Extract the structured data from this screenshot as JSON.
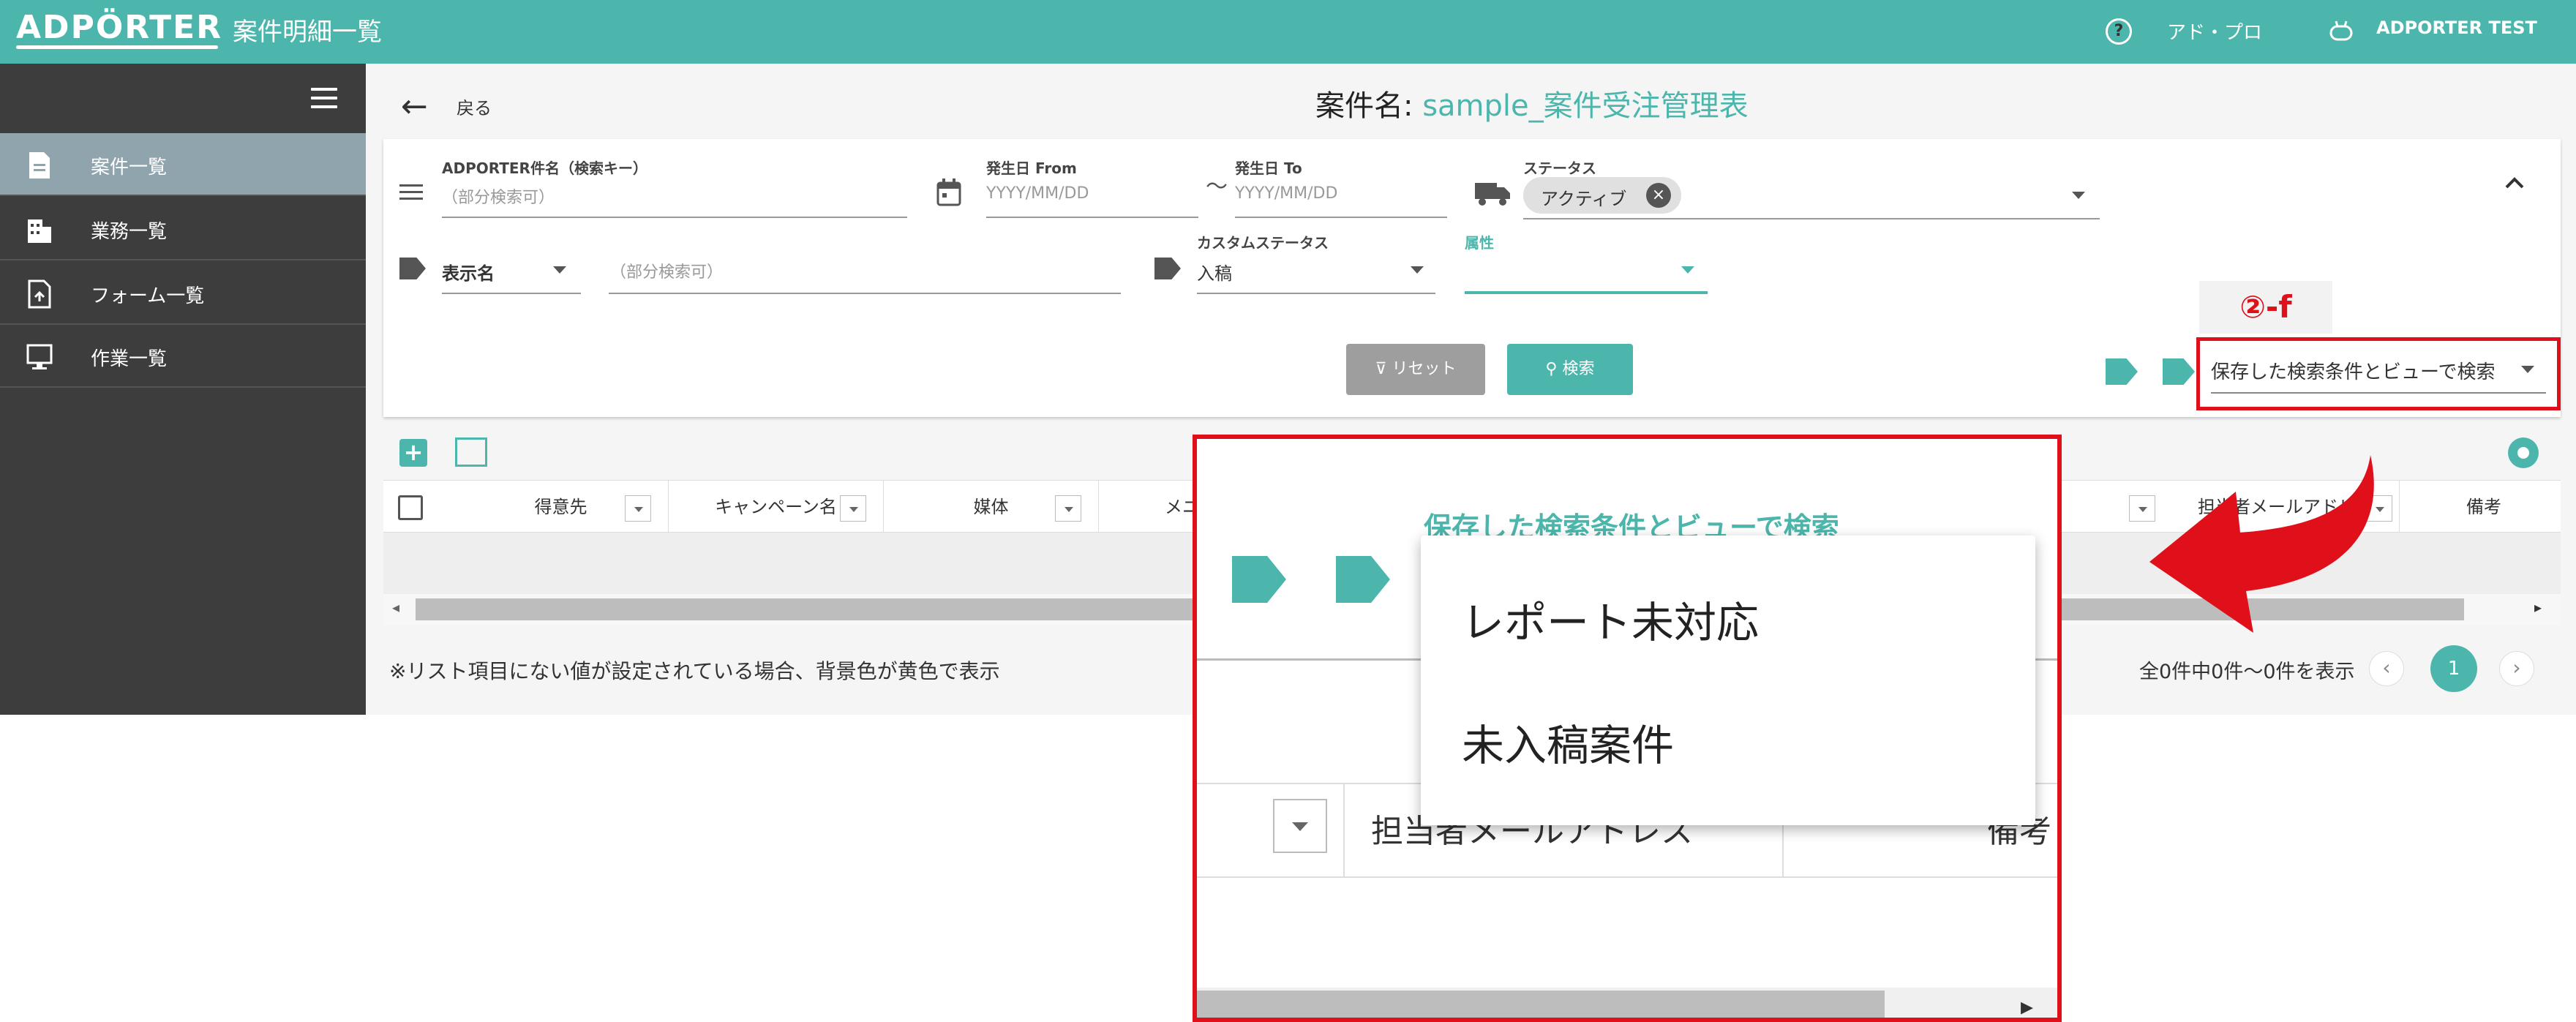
{
  "app": {
    "logo": "ADPÖRTER",
    "title": "案件明細一覧",
    "help_label": "アド・プロ",
    "user_label": "ADPORTER TEST"
  },
  "sidebar": {
    "items": [
      {
        "label": "案件一覧"
      },
      {
        "label": "業務一覧"
      },
      {
        "label": "フォーム一覧"
      },
      {
        "label": "作業一覧"
      }
    ]
  },
  "header": {
    "back_label": "戻る",
    "case_prefix": "案件名: ",
    "case_name": "sample_案件受注管理表"
  },
  "filters": {
    "keyword_label": "ADPORTER件名（検索キー）",
    "keyword_placeholder": "（部分検索可）",
    "date_from_label": "発生日 From",
    "date_from_placeholder": "YYYY/MM/DD",
    "tilde": "～",
    "date_to_label": "発生日 To",
    "date_to_placeholder": "YYYY/MM/DD",
    "status_label": "ステータス",
    "status_chip": "アクティブ",
    "display_name_label": "表示名",
    "display_name_placeholder": "（部分検索可）",
    "custom_status_label": "カスタムステータス",
    "custom_status_value": "入稿",
    "attribute_label": "属性",
    "reset_label": "リセット",
    "search_label": "検索",
    "saved_search_label": "保存した検索条件とビューで検索"
  },
  "annotation": {
    "label": "②-f"
  },
  "table": {
    "columns": [
      "得意先",
      "キャンペーン名",
      "媒体",
      "メニュ",
      "担当者メールアドレ",
      "備考"
    ]
  },
  "footer": {
    "note": "※リスト項目にない値が設定されている場合、背景色が黄色で表示",
    "count": "全0件中0件～0件を表示",
    "page": "1"
  },
  "zoom": {
    "title": "保存した検索条件とビューで検索",
    "column_label": "担当者メールアドレス",
    "column_label2": "備考",
    "menu_items": [
      "レポート未対応",
      "未入稿案件"
    ]
  },
  "colors": {
    "accent": "#4db6ac",
    "sidebar_bg": "#3d3d3d",
    "sidebar_active": "#90a4ae",
    "highlight_red": "#e0101a"
  }
}
